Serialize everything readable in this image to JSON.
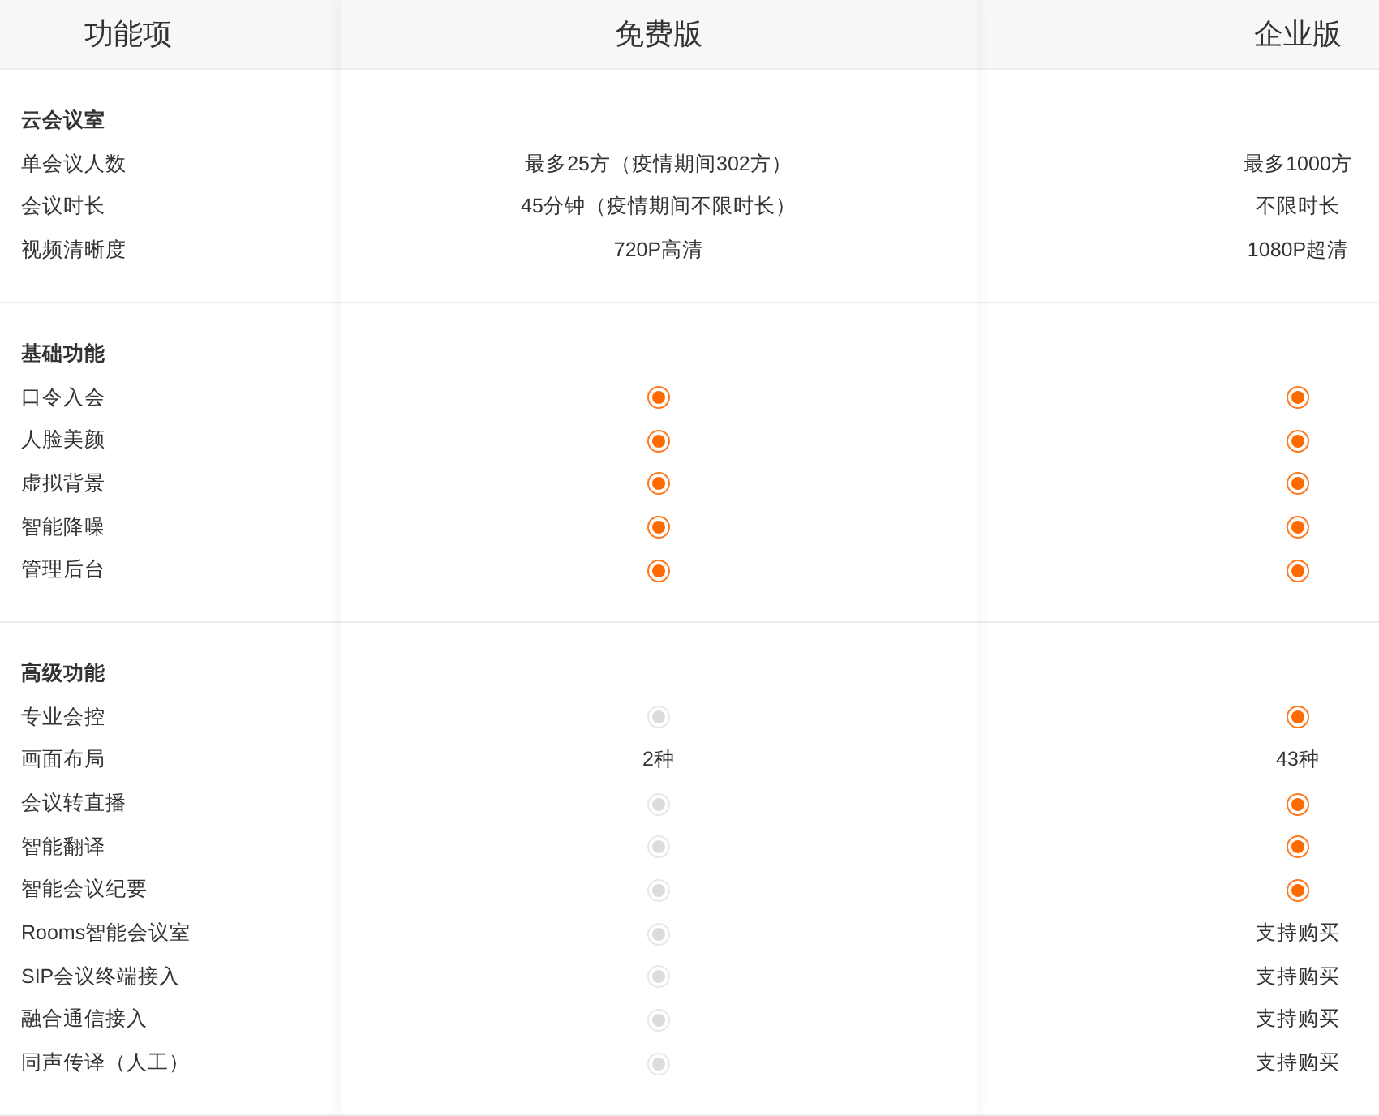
{
  "columns": [
    {
      "title": "功能项"
    },
    {
      "title": "免费版"
    },
    {
      "title": "企业版"
    }
  ],
  "sections": [
    {
      "title": "云会议室",
      "rows": [
        {
          "feature": "单会议人数",
          "cells": [
            {
              "kind": "text",
              "text": "最多25方（疫情期间302方）"
            },
            {
              "kind": "text",
              "text": "最多1000方"
            }
          ]
        },
        {
          "feature": "会议时长",
          "cells": [
            {
              "kind": "text",
              "text": "45分钟（疫情期间不限时长）"
            },
            {
              "kind": "text",
              "text": "不限时长"
            }
          ]
        },
        {
          "feature": "视频清晰度",
          "cells": [
            {
              "kind": "text",
              "text": "720P高清"
            },
            {
              "kind": "text",
              "text": "1080P超清"
            }
          ]
        }
      ]
    },
    {
      "title": "基础功能",
      "rows": [
        {
          "feature": "口令入会",
          "cells": [
            {
              "kind": "dot",
              "supported": true
            },
            {
              "kind": "dot",
              "supported": true
            }
          ]
        },
        {
          "feature": "人脸美颜",
          "cells": [
            {
              "kind": "dot",
              "supported": true
            },
            {
              "kind": "dot",
              "supported": true
            }
          ]
        },
        {
          "feature": "虚拟背景",
          "cells": [
            {
              "kind": "dot",
              "supported": true
            },
            {
              "kind": "dot",
              "supported": true
            }
          ]
        },
        {
          "feature": "智能降噪",
          "cells": [
            {
              "kind": "dot",
              "supported": true
            },
            {
              "kind": "dot",
              "supported": true
            }
          ]
        },
        {
          "feature": "管理后台",
          "cells": [
            {
              "kind": "dot",
              "supported": true
            },
            {
              "kind": "dot",
              "supported": true
            }
          ]
        }
      ]
    },
    {
      "title": "高级功能",
      "rows": [
        {
          "feature": "专业会控",
          "cells": [
            {
              "kind": "dot",
              "supported": false
            },
            {
              "kind": "dot",
              "supported": true
            }
          ]
        },
        {
          "feature": "画面布局",
          "cells": [
            {
              "kind": "text",
              "text": "2种"
            },
            {
              "kind": "text",
              "text": "43种"
            }
          ]
        },
        {
          "feature": "会议转直播",
          "cells": [
            {
              "kind": "dot",
              "supported": false
            },
            {
              "kind": "dot",
              "supported": true
            }
          ]
        },
        {
          "feature": "智能翻译",
          "cells": [
            {
              "kind": "dot",
              "supported": false
            },
            {
              "kind": "dot",
              "supported": true
            }
          ]
        },
        {
          "feature": "智能会议纪要",
          "cells": [
            {
              "kind": "dot",
              "supported": false
            },
            {
              "kind": "dot",
              "supported": true
            }
          ]
        },
        {
          "feature": "Rooms智能会议室",
          "cells": [
            {
              "kind": "dot",
              "supported": false
            },
            {
              "kind": "text",
              "text": "支持购买"
            }
          ]
        },
        {
          "feature": "SIP会议终端接入",
          "cells": [
            {
              "kind": "dot",
              "supported": false
            },
            {
              "kind": "text",
              "text": "支持购买"
            }
          ]
        },
        {
          "feature": "融合通信接入",
          "cells": [
            {
              "kind": "dot",
              "supported": false
            },
            {
              "kind": "text",
              "text": "支持购买"
            }
          ]
        },
        {
          "feature": "同声传译（人工）",
          "cells": [
            {
              "kind": "dot",
              "supported": false
            },
            {
              "kind": "text",
              "text": "支持购买"
            }
          ]
        }
      ]
    }
  ]
}
